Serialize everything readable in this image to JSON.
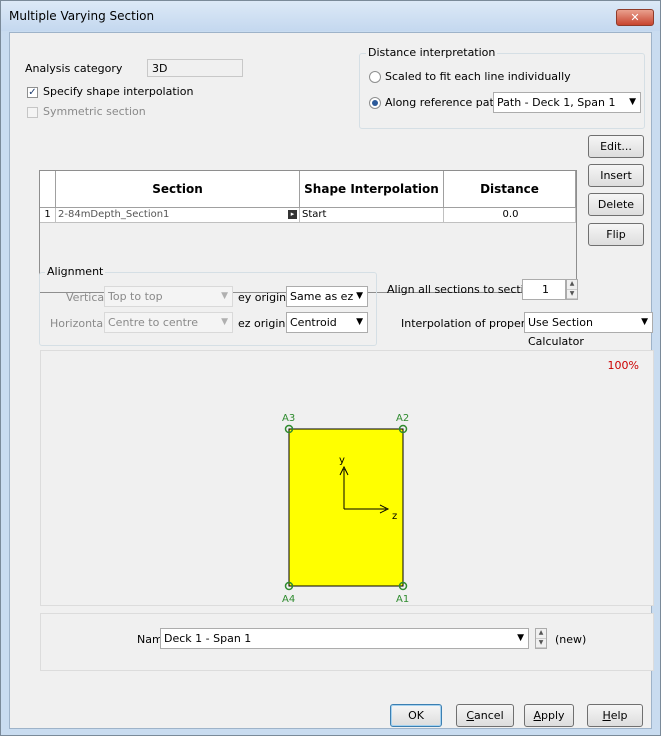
{
  "window": {
    "title": "Multiple Varying Section",
    "close_glyph": "✕"
  },
  "analysis": {
    "label": "Analysis category",
    "value": "3D"
  },
  "options": {
    "specify_interpolation": "Specify shape interpolation",
    "symmetric": "Symmetric section"
  },
  "distance_interp": {
    "legend": "Distance interpretation",
    "scaled": "Scaled to fit each line individually",
    "along": "Along reference path",
    "path_value": "Path - Deck 1, Span 1"
  },
  "table": {
    "headers": [
      "Section",
      "Shape Interpolation",
      "Distance"
    ],
    "rows": [
      {
        "num": "1",
        "section": "2-84mDepth_Section1",
        "interp": "Start",
        "distance": "0.0"
      }
    ]
  },
  "side_buttons": {
    "edit": "Edit...",
    "insert": "Insert",
    "delete": "Delete",
    "flip": "Flip"
  },
  "alignment": {
    "legend": "Alignment",
    "vertical_label": "Vertical",
    "vertical_value": "Top to top",
    "horizontal_label": "Horizontal",
    "horizontal_value": "Centre to centre",
    "ey_label": "ey origin",
    "ey_value": "Same as ez",
    "ez_label": "ez origin",
    "ez_value": "Centroid"
  },
  "align_all": {
    "label": "Align all sections to section",
    "value": "1"
  },
  "interp_props": {
    "label": "Interpolation of properties",
    "value": "Use Section Calculator"
  },
  "preview": {
    "zoom": "100%",
    "points": {
      "a1": "A1",
      "a2": "A2",
      "a3": "A3",
      "a4": "A4"
    },
    "axis_y": "y",
    "axis_z": "z",
    "fill": "#ffff00",
    "point_color": "#2e8b2e"
  },
  "name_row": {
    "label": "Name",
    "value": "Deck 1 - Span 1",
    "note": "(new)"
  },
  "footer": {
    "ok": "OK",
    "cancel_first": "C",
    "cancel_rest": "ancel",
    "apply_first": "A",
    "apply_rest": "pply",
    "help_first": "H",
    "help_rest": "elp"
  }
}
